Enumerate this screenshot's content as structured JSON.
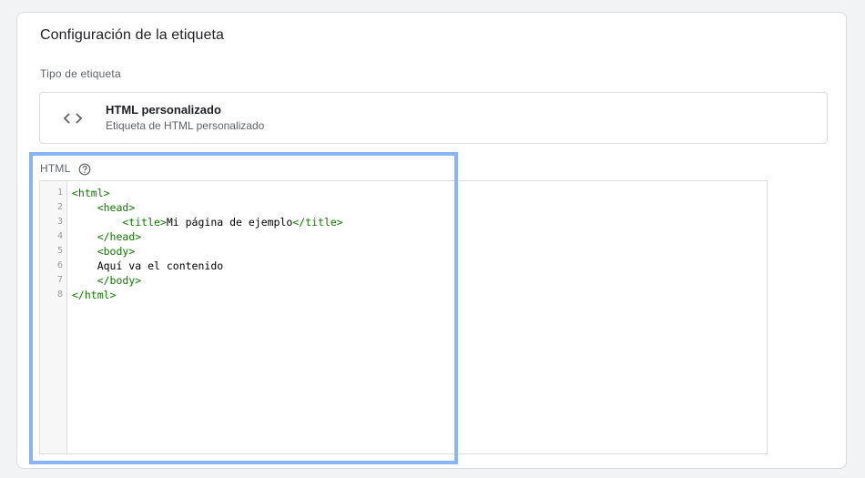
{
  "card": {
    "title": "Configuración de la etiqueta"
  },
  "tag_type": {
    "section_label": "Tipo de etiqueta",
    "icon": "code-brackets-icon",
    "name": "HTML personalizado",
    "description": "Etiqueta de HTML personalizado"
  },
  "html_field": {
    "label": "HTML",
    "help_icon": "help-circle-icon"
  },
  "editor": {
    "line_numbers": [
      "1",
      "2",
      "3",
      "4",
      "5",
      "6",
      "7",
      "8"
    ],
    "lines": [
      [
        {
          "t": "tag",
          "v": "<html>"
        }
      ],
      [
        {
          "t": "text",
          "v": "    "
        },
        {
          "t": "tag",
          "v": "<head>"
        }
      ],
      [
        {
          "t": "text",
          "v": "        "
        },
        {
          "t": "tag",
          "v": "<title>"
        },
        {
          "t": "text",
          "v": "Mi página de ejemplo"
        },
        {
          "t": "tag",
          "v": "</title>"
        }
      ],
      [
        {
          "t": "text",
          "v": "    "
        },
        {
          "t": "tag",
          "v": "</head>"
        }
      ],
      [
        {
          "t": "text",
          "v": "    "
        },
        {
          "t": "tag",
          "v": "<body>"
        }
      ],
      [
        {
          "t": "text",
          "v": "    Aquí va el contenido"
        }
      ],
      [
        {
          "t": "text",
          "v": "    "
        },
        {
          "t": "tag",
          "v": "</body>"
        }
      ],
      [
        {
          "t": "tag",
          "v": "</html>"
        }
      ]
    ]
  },
  "colors": {
    "tag": "#117700",
    "text": "#000000",
    "highlight": "#8ab4f8"
  }
}
